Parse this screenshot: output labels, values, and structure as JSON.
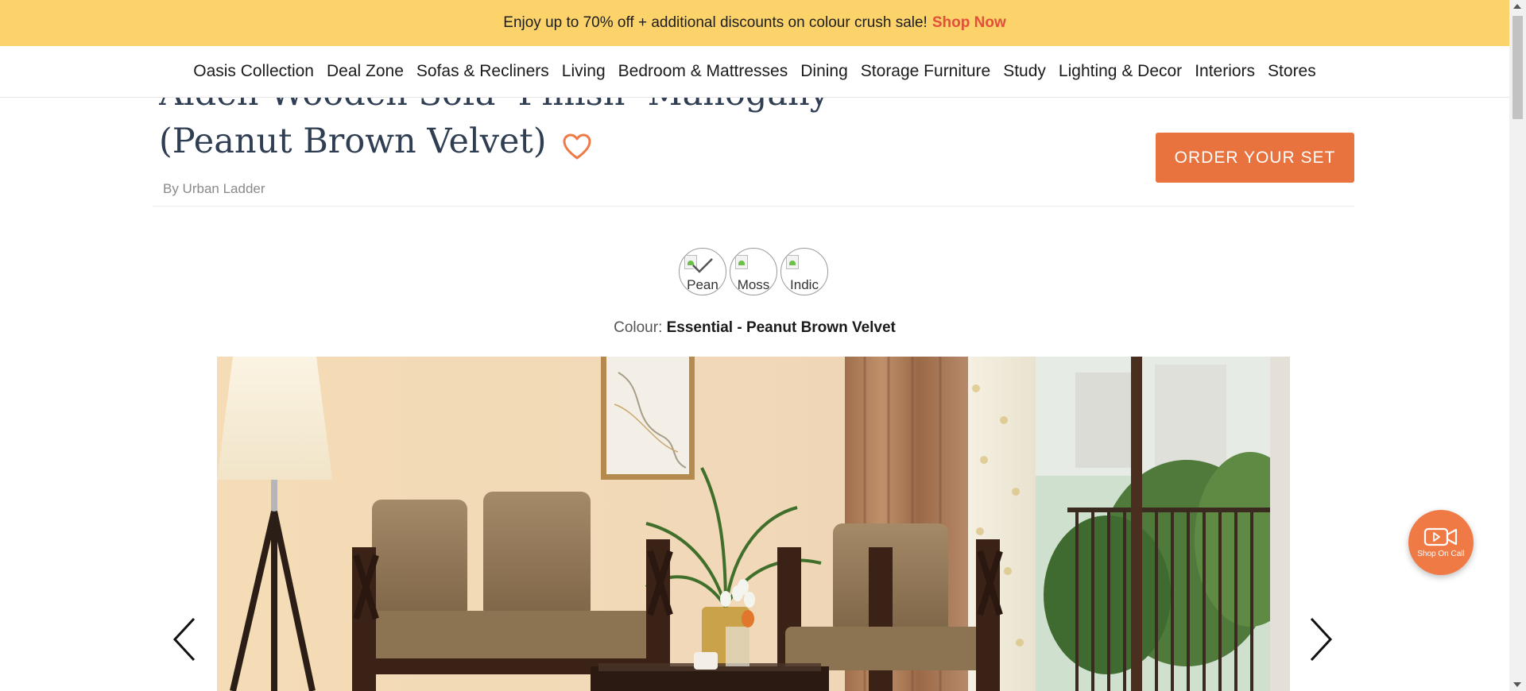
{
  "promo": {
    "text": "Enjoy up to 70% off + additional discounts on colour crush sale!",
    "cta": "Shop Now"
  },
  "nav": {
    "items": [
      "Oasis Collection",
      "Deal Zone",
      "Sofas & Recliners",
      "Living",
      "Bedroom & Mattresses",
      "Dining",
      "Storage Furniture",
      "Study",
      "Lighting & Decor",
      "Interiors",
      "Stores"
    ]
  },
  "product": {
    "title_line1": "Alden Wooden Sofa -Finish- Mahogany",
    "title_line2": "(Peanut Brown Velvet)",
    "by": "By Urban Ladder",
    "order_button": "ORDER YOUR SET"
  },
  "swatches": [
    {
      "label": "Pean",
      "selected": true
    },
    {
      "label": "Moss",
      "selected": false
    },
    {
      "label": "Indic",
      "selected": false
    }
  ],
  "colour": {
    "label": "Colour:",
    "value": "Essential - Peanut Brown Velvet"
  },
  "shop_on_call": {
    "label": "Shop On Call"
  },
  "icons": {
    "heart": "heart-icon",
    "prev": "chevron-left-icon",
    "next": "chevron-right-icon",
    "video": "video-camera-icon"
  },
  "colors": {
    "promo_bg": "#fbd36a",
    "accent": "#e8733f",
    "shop_now": "#e2503b",
    "title": "#2f3e52"
  }
}
